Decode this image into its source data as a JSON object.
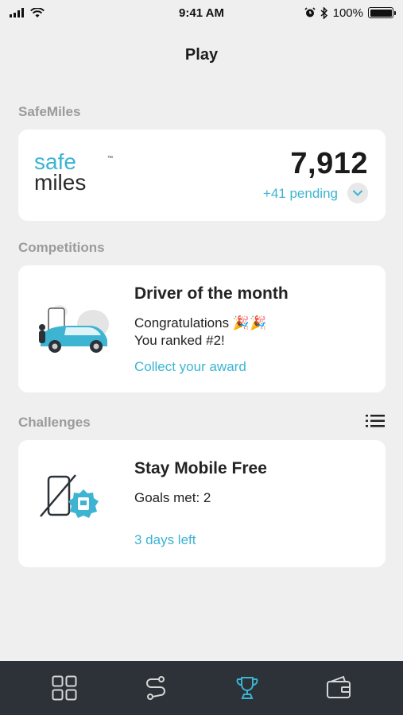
{
  "status_bar": {
    "time": "9:41 AM",
    "battery_percent": "100%"
  },
  "page": {
    "title": "Play"
  },
  "safemiles": {
    "section_label": "SafeMiles",
    "logo_top": "safe",
    "logo_bottom": "miles",
    "logo_tm": "™",
    "points": "7,912",
    "pending": "+41 pending"
  },
  "competitions": {
    "section_label": "Competitions",
    "title": "Driver of the month",
    "line1": "Congratulations 🎉🎉",
    "line2": "You ranked #2!",
    "link": "Collect your award"
  },
  "challenges": {
    "section_label": "Challenges",
    "title": "Stay Mobile Free",
    "goals": "Goals met: 2",
    "link": "3 days left"
  },
  "tabs": [
    {
      "name": "dashboard-grid-icon",
      "active": false
    },
    {
      "name": "trips-route-icon",
      "active": false
    },
    {
      "name": "trophy-icon",
      "active": true
    },
    {
      "name": "wallet-icon",
      "active": false
    }
  ],
  "colors": {
    "accent": "#3cb4d2",
    "tab_bar": "#2c3238",
    "background": "#efefef"
  }
}
